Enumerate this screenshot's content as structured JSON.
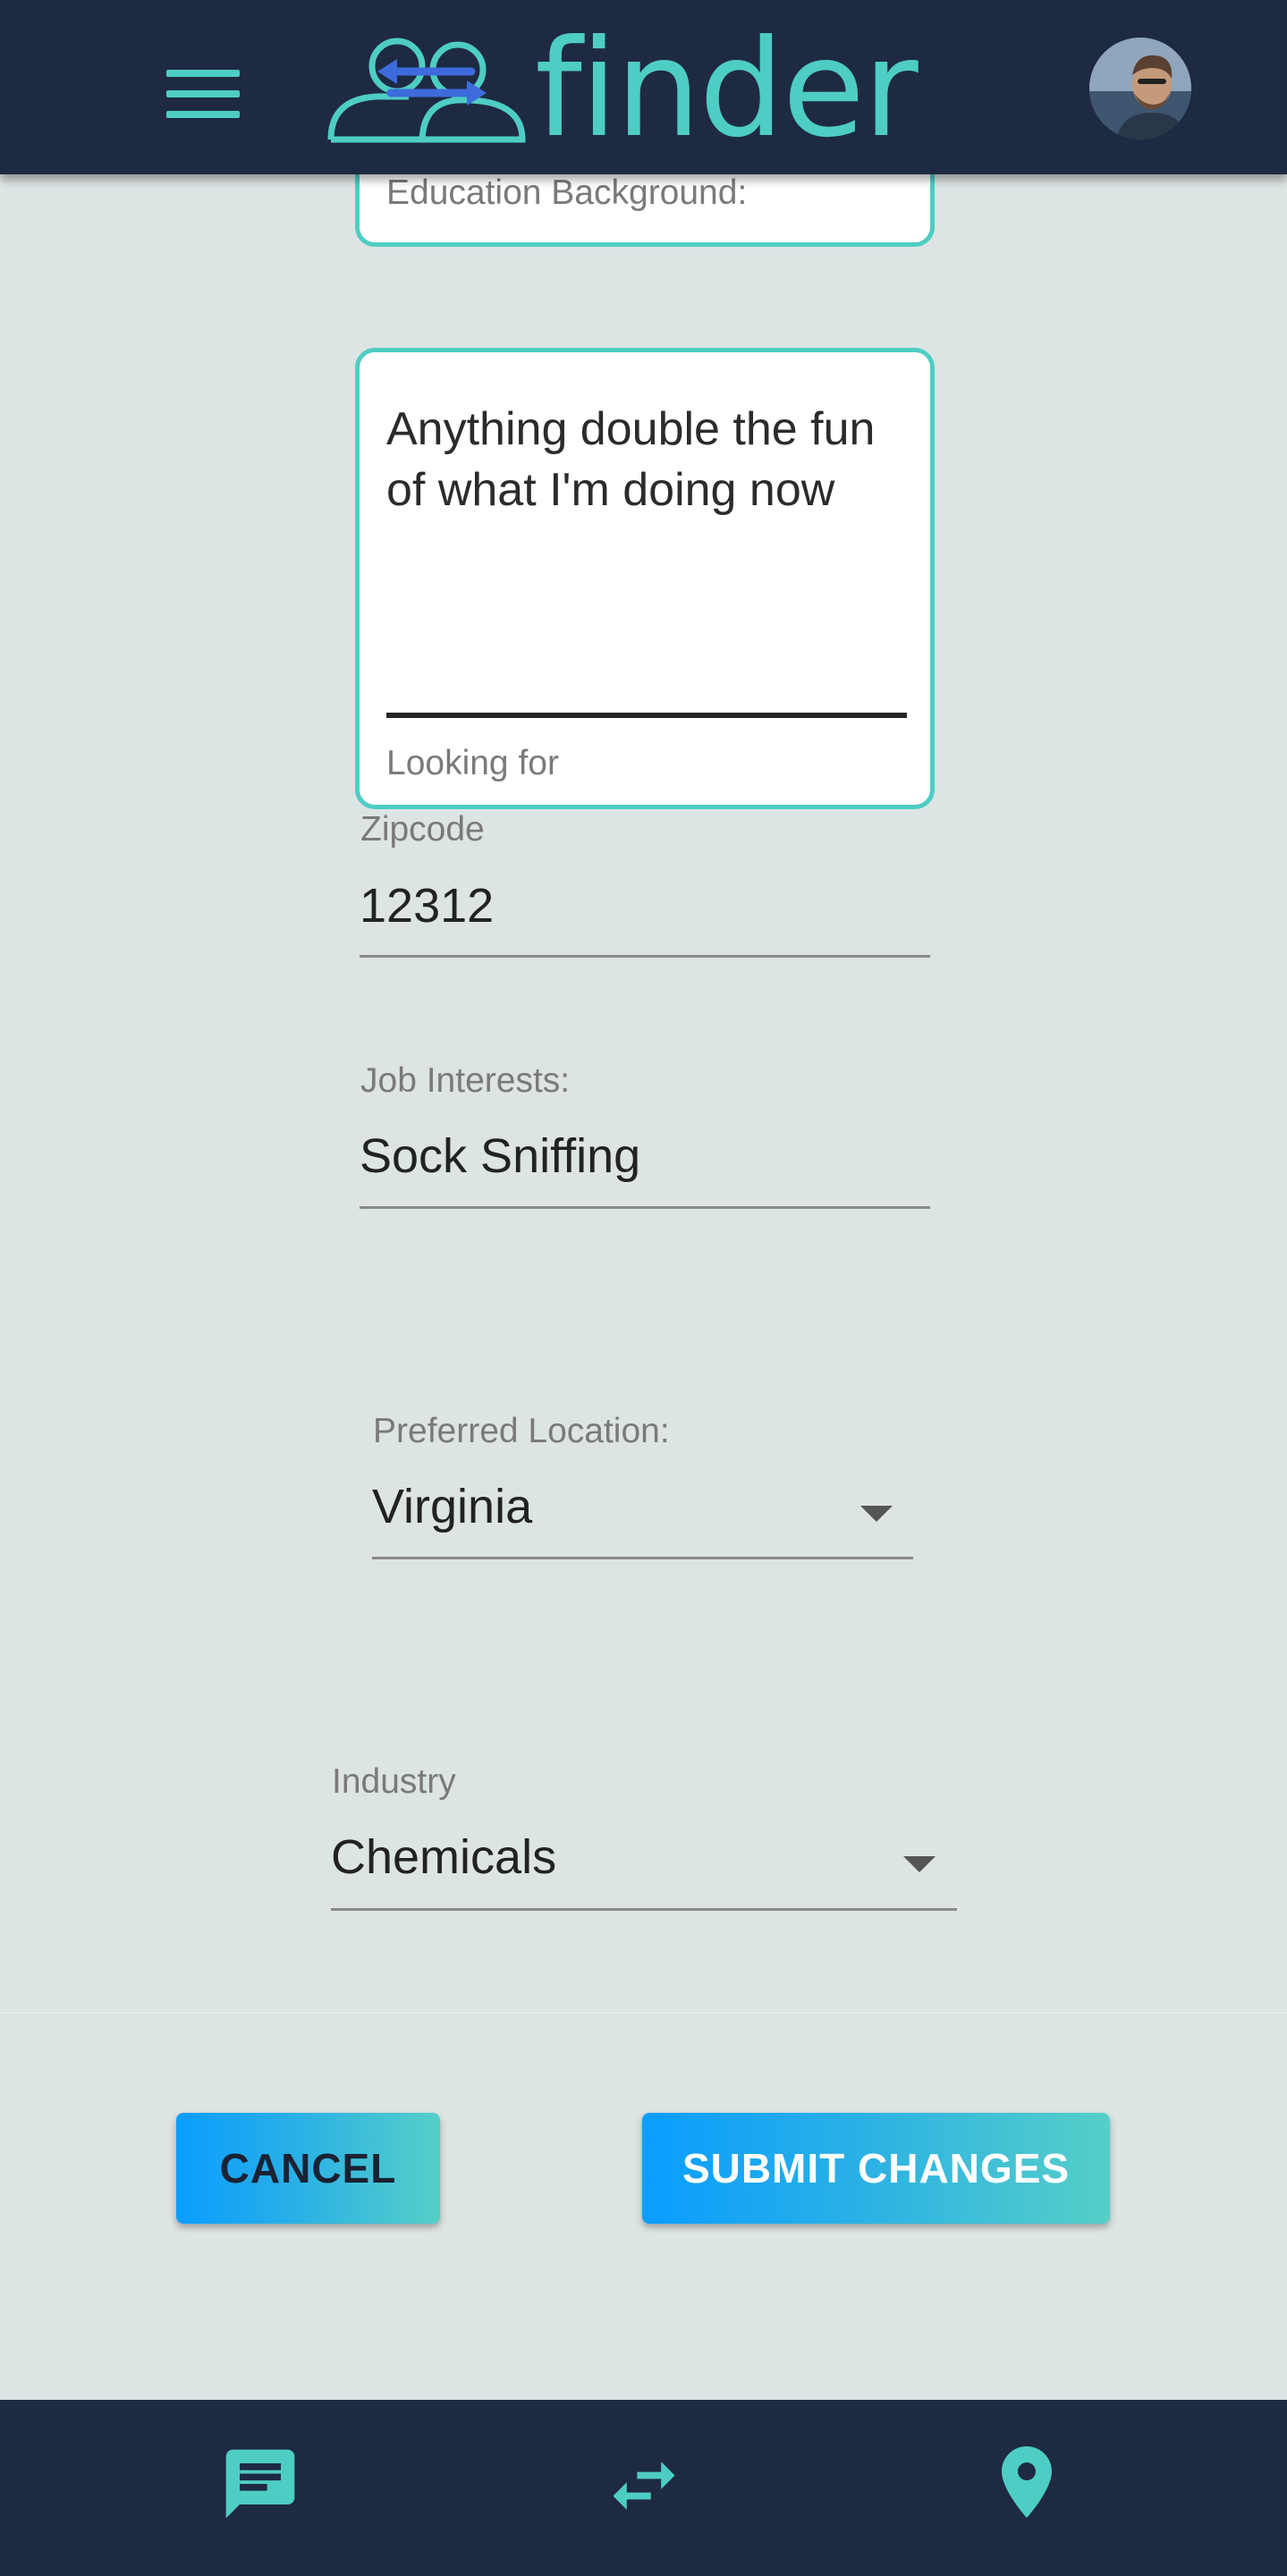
{
  "header": {
    "app_name": "finder",
    "menu_icon": "hamburger-menu-icon",
    "logo_icon": "people-exchange-logo-icon",
    "avatar_icon": "user-avatar"
  },
  "form": {
    "education": {
      "label": "Education Background:"
    },
    "looking_for": {
      "value": "Anything double the fun of what I'm doing now",
      "label": "Looking for"
    },
    "zipcode": {
      "label": "Zipcode",
      "value": "12312"
    },
    "job_interests": {
      "label": "Job Interests:",
      "value": "Sock Sniffing"
    },
    "preferred_location": {
      "label": "Preferred Location:",
      "value": "Virginia"
    },
    "industry": {
      "label": "Industry",
      "value": "Chemicals"
    }
  },
  "actions": {
    "cancel_label": "CANCEL",
    "submit_label": "SUBMIT CHANGES"
  },
  "bottom_nav": {
    "items": [
      {
        "icon": "chat-icon"
      },
      {
        "icon": "swap-arrows-icon"
      },
      {
        "icon": "location-pin-icon"
      }
    ]
  },
  "colors": {
    "header_bg": "#1e2a42",
    "accent": "#4ecdc4",
    "page_bg": "#dde4e4",
    "button_gradient_start": "#0a9dff",
    "button_gradient_end": "#56cfc8"
  }
}
